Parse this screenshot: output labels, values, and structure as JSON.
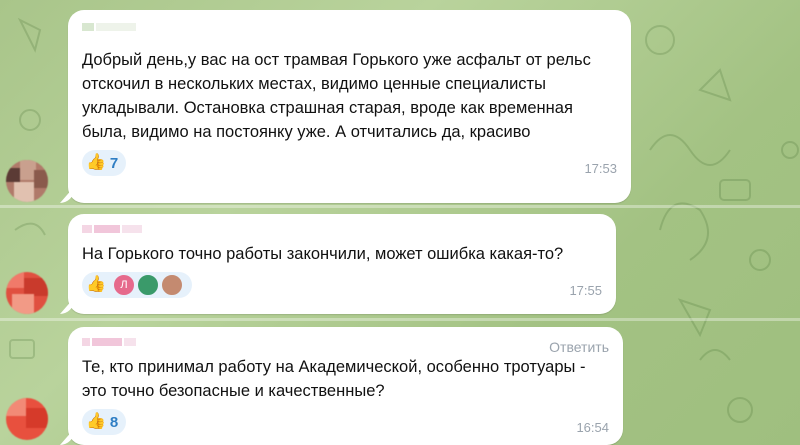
{
  "messages": [
    {
      "text": "Добрый день,у вас на ост трамвая Горького уже асфальт от рельс отскочил в нескольких местах, видимо ценные специалисты укладывали. Остановка страшная старая, вроде как временная была, видимо на постоянку уже. А отчитались да, красиво",
      "reaction_emoji": "👍",
      "reaction_count": "7",
      "time": "17:53"
    },
    {
      "text": "На Горького точно работы закончили, может ошибка какая-то?",
      "reaction_emoji": "👍",
      "reactor_initial": "Л",
      "time": "17:55"
    },
    {
      "text": "Те, кто принимал работу на Академической, особенно тротуары - это точно безопасные и качественные?",
      "reply_label": "Ответить",
      "reaction_emoji": "👍",
      "reaction_count": "8",
      "time": "16:54"
    }
  ],
  "colors": {
    "background": "#a9c58a",
    "bubble": "#ffffff",
    "reaction_bg": "#e6f1fb",
    "reaction_count": "#2f7ec4",
    "timestamp": "#9aa3ad"
  }
}
